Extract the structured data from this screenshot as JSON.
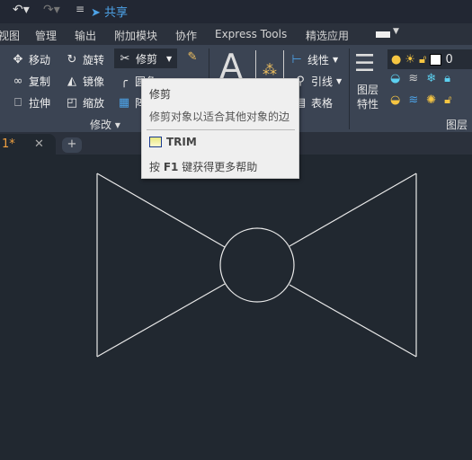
{
  "quick_access": {
    "share_label": "共享"
  },
  "menu": {
    "items": [
      "视图",
      "管理",
      "输出",
      "附加模块",
      "协作",
      "Express Tools",
      "精选应用"
    ]
  },
  "ribbon": {
    "modify": {
      "move": "移动",
      "rotate": "旋转",
      "trim": "修剪",
      "copy": "复制",
      "mirror": "镜像",
      "fillet": "圆角",
      "stretch": "拉伸",
      "scale": "缩放",
      "array": "阵列",
      "title": "修改"
    },
    "annotation": {
      "linear": "线性",
      "leader": "引线",
      "table": "表格"
    },
    "layers": {
      "properties_line1": "图层",
      "properties_line2": "特性",
      "current_layer": "0",
      "title": "图层"
    }
  },
  "tabs": {
    "drawing_tab": "1*",
    "close": "✕",
    "add": "+"
  },
  "tooltip": {
    "title": "修剪",
    "description": "修剪对象以适合其他对象的边",
    "command": "TRIM",
    "help_prefix": "按 ",
    "help_key": "F1",
    "help_suffix": " 键获得更多帮助"
  },
  "colors": {
    "accent": "#4da3e8",
    "canvas": "#212830",
    "ribbon": "#3b4453"
  }
}
